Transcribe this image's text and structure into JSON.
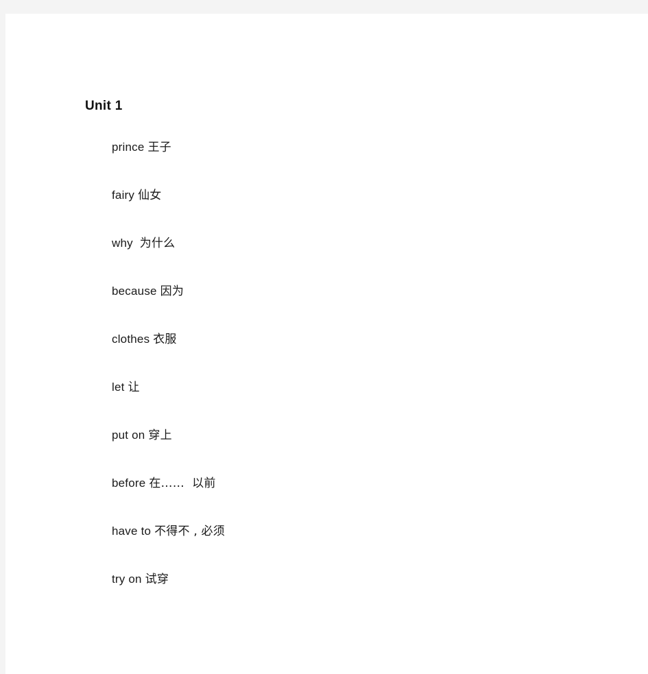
{
  "page": {
    "background_color": "#f4f4f4",
    "sheet_color": "#ffffff",
    "text_color": "#1a1a1a"
  },
  "document": {
    "title": "Unit 1",
    "vocabulary": [
      {
        "term": "prince",
        "gap": " ",
        "gloss": "王子"
      },
      {
        "term": "fairy",
        "gap": " ",
        "gloss": "仙女"
      },
      {
        "term": "why",
        "gap": "  ",
        "gloss": "为什么"
      },
      {
        "term": "because",
        "gap": " ",
        "gloss": "因为"
      },
      {
        "term": "clothes",
        "gap": " ",
        "gloss": "衣服"
      },
      {
        "term": "let",
        "gap": " ",
        "gloss": "让"
      },
      {
        "term": "put on",
        "gap": " ",
        "gloss": "穿上"
      },
      {
        "term": "before",
        "gap": " ",
        "gloss": "在……  以前"
      },
      {
        "term": "have to",
        "gap": " ",
        "gloss": "不得不 , 必须"
      },
      {
        "term": "try on",
        "gap": " ",
        "gloss": "试穿"
      }
    ]
  }
}
